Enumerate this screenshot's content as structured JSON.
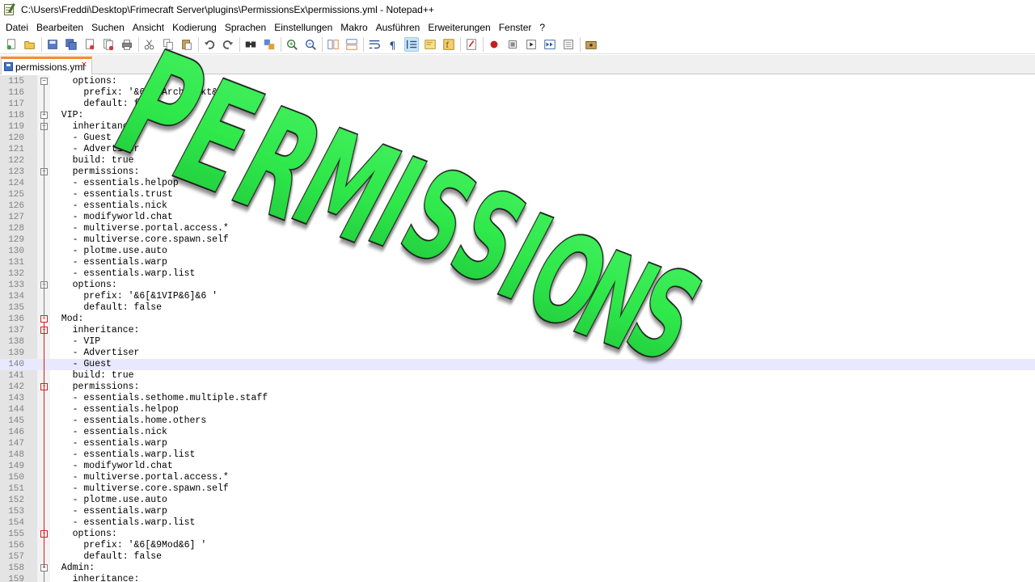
{
  "window": {
    "title": "C:\\Users\\Freddi\\Desktop\\Frimecraft Server\\plugins\\PermissionsEx\\permissions.yml - Notepad++"
  },
  "menu": [
    "Datei",
    "Bearbeiten",
    "Suchen",
    "Ansicht",
    "Kodierung",
    "Sprachen",
    "Einstellungen",
    "Makro",
    "Ausführen",
    "Erweiterungen",
    "Fenster",
    "?"
  ],
  "toolbar": {
    "icons": [
      "new-file-icon",
      "open-file-icon",
      "save-icon",
      "save-all-icon",
      "close-icon",
      "close-all-icon",
      "print-icon",
      "cut-icon",
      "copy-icon",
      "paste-icon",
      "undo-icon",
      "redo-icon",
      "find-icon",
      "replace-icon",
      "zoom-in-icon",
      "zoom-out-icon",
      "sync-vertical-icon",
      "sync-horizontal-icon",
      "word-wrap-icon",
      "show-all-characters-icon",
      "indent-guide-icon",
      "doc-map-icon",
      "function-list-icon",
      "folder-as-workspace-icon",
      "record-macro-icon",
      "stop-recording-icon",
      "play-macro-icon",
      "run-macro-multiple-icon",
      "save-macro-icon",
      "monitoring-icon"
    ]
  },
  "tab": {
    "label": "permissions.yml",
    "close_symbol": "✕"
  },
  "editor": {
    "current_line": 140,
    "lines": [
      {
        "n": "115",
        "text": "    options:"
      },
      {
        "n": "116",
        "text": "      prefix: '&6[&3Architekt&6]&6 '"
      },
      {
        "n": "117",
        "text": "      default: false"
      },
      {
        "n": "118",
        "text": "  VIP:"
      },
      {
        "n": "119",
        "text": "    inheritance:"
      },
      {
        "n": "120",
        "text": "    - Guest"
      },
      {
        "n": "121",
        "text": "    - Advertiser"
      },
      {
        "n": "122",
        "text": "    build: true"
      },
      {
        "n": "123",
        "text": "    permissions:"
      },
      {
        "n": "124",
        "text": "    - essentials.helpop"
      },
      {
        "n": "125",
        "text": "    - essentials.trust"
      },
      {
        "n": "126",
        "text": "    - essentials.nick"
      },
      {
        "n": "127",
        "text": "    - modifyworld.chat"
      },
      {
        "n": "128",
        "text": "    - multiverse.portal.access.*"
      },
      {
        "n": "129",
        "text": "    - multiverse.core.spawn.self"
      },
      {
        "n": "130",
        "text": "    - plotme.use.auto"
      },
      {
        "n": "131",
        "text": "    - essentials.warp"
      },
      {
        "n": "132",
        "text": "    - essentials.warp.list"
      },
      {
        "n": "133",
        "text": "    options:"
      },
      {
        "n": "134",
        "text": "      prefix: '&6[&1VIP&6]&6 '"
      },
      {
        "n": "135",
        "text": "      default: false"
      },
      {
        "n": "136",
        "text": "  Mod:"
      },
      {
        "n": "137",
        "text": "    inheritance:"
      },
      {
        "n": "138",
        "text": "    - VIP"
      },
      {
        "n": "139",
        "text": "    - Advertiser"
      },
      {
        "n": "140",
        "text": "    - Guest"
      },
      {
        "n": "141",
        "text": "    build: true"
      },
      {
        "n": "142",
        "text": "    permissions:"
      },
      {
        "n": "143",
        "text": "    - essentials.sethome.multiple.staff"
      },
      {
        "n": "144",
        "text": "    - essentials.helpop"
      },
      {
        "n": "145",
        "text": "    - essentials.home.others"
      },
      {
        "n": "146",
        "text": "    - essentials.nick"
      },
      {
        "n": "147",
        "text": "    - essentials.warp"
      },
      {
        "n": "148",
        "text": "    - essentials.warp.list"
      },
      {
        "n": "149",
        "text": "    - modifyworld.chat"
      },
      {
        "n": "150",
        "text": "    - multiverse.portal.access.*"
      },
      {
        "n": "151",
        "text": "    - multiverse.core.spawn.self"
      },
      {
        "n": "152",
        "text": "    - plotme.use.auto"
      },
      {
        "n": "153",
        "text": "    - essentials.warp"
      },
      {
        "n": "154",
        "text": "    - essentials.warp.list"
      },
      {
        "n": "155",
        "text": "    options:"
      },
      {
        "n": "156",
        "text": "      prefix: '&6[&9Mod&6] '"
      },
      {
        "n": "157",
        "text": "      default: false"
      },
      {
        "n": "158",
        "text": "  Admin:"
      },
      {
        "n": "159",
        "text": "    inheritance:"
      }
    ]
  },
  "overlay": {
    "word": "PERMISSIONS",
    "fill_color": "#2ee84a",
    "outline_color": "#1a1a1a"
  }
}
